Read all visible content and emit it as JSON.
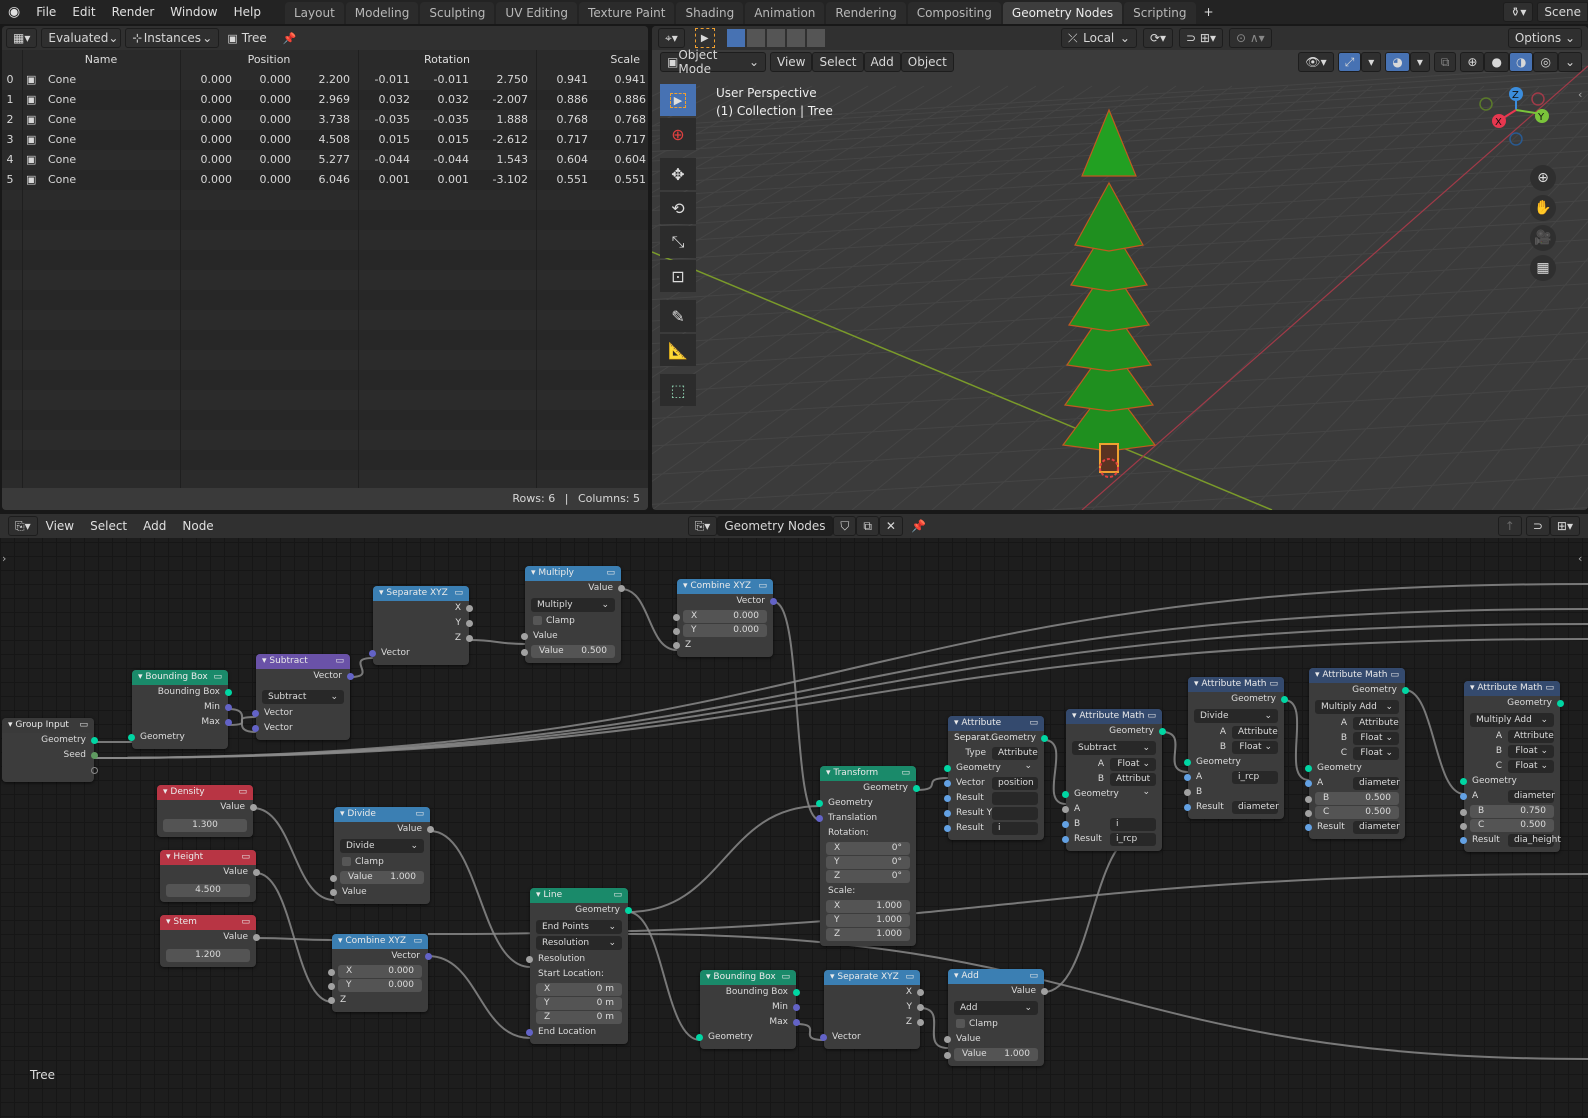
{
  "topbar": {
    "menus": [
      "File",
      "Edit",
      "Render",
      "Window",
      "Help"
    ],
    "workspaces": [
      "Layout",
      "Modeling",
      "Sculpting",
      "UV Editing",
      "Texture Paint",
      "Shading",
      "Animation",
      "Rendering",
      "Compositing",
      "Geometry Nodes",
      "Scripting"
    ],
    "active_workspace": "Geometry Nodes",
    "add_tab": "+",
    "scene_label": "Scene"
  },
  "spreadsheet": {
    "mode": "Evaluated",
    "domain": "Instances",
    "object": "Tree",
    "columns": [
      "Name",
      "Position",
      "Rotation",
      "Scale"
    ],
    "rows": [
      {
        "idx": "0",
        "name": "Cone",
        "pos": [
          "0.000",
          "0.000",
          "2.200"
        ],
        "rot": [
          "-0.011",
          "-0.011",
          "2.750"
        ],
        "scale": [
          "0.941",
          "0.941"
        ]
      },
      {
        "idx": "1",
        "name": "Cone",
        "pos": [
          "0.000",
          "0.000",
          "2.969"
        ],
        "rot": [
          "0.032",
          "0.032",
          "-2.007"
        ],
        "scale": [
          "0.886",
          "0.886"
        ]
      },
      {
        "idx": "2",
        "name": "Cone",
        "pos": [
          "0.000",
          "0.000",
          "3.738"
        ],
        "rot": [
          "-0.035",
          "-0.035",
          "1.888"
        ],
        "scale": [
          "0.768",
          "0.768"
        ]
      },
      {
        "idx": "3",
        "name": "Cone",
        "pos": [
          "0.000",
          "0.000",
          "4.508"
        ],
        "rot": [
          "0.015",
          "0.015",
          "-2.612"
        ],
        "scale": [
          "0.717",
          "0.717"
        ]
      },
      {
        "idx": "4",
        "name": "Cone",
        "pos": [
          "0.000",
          "0.000",
          "5.277"
        ],
        "rot": [
          "-0.044",
          "-0.044",
          "1.543"
        ],
        "scale": [
          "0.604",
          "0.604"
        ]
      },
      {
        "idx": "5",
        "name": "Cone",
        "pos": [
          "0.000",
          "0.000",
          "6.046"
        ],
        "rot": [
          "0.001",
          "0.001",
          "-3.102"
        ],
        "scale": [
          "0.551",
          "0.551"
        ]
      }
    ],
    "footer_rows": "Rows: 6",
    "footer_sep": "|",
    "footer_cols": "Columns: 5"
  },
  "viewport": {
    "transform_orientation": "Local",
    "options": "Options",
    "mode": "Object Mode",
    "menus": [
      "View",
      "Select",
      "Add",
      "Object"
    ],
    "overlay_title": "User Perspective",
    "overlay_sub": "(1) Collection | Tree",
    "gizmo_axes": [
      "X",
      "Y",
      "Z"
    ]
  },
  "node_editor": {
    "menus": [
      "View",
      "Select",
      "Add",
      "Node"
    ],
    "tree_name": "Geometry Nodes",
    "footer_label": "Tree",
    "nodes": {
      "group_input": {
        "title": "Group Input",
        "outputs": [
          "Geometry",
          "Seed"
        ]
      },
      "bbox1": {
        "title": "Bounding Box",
        "outputs": [
          "Bounding Box",
          "Min",
          "Max"
        ],
        "inputs": [
          "Geometry"
        ]
      },
      "subtract": {
        "title": "Subtract",
        "output": "Vector",
        "op": "Subtract",
        "inputs": [
          "Vector",
          "Vector"
        ]
      },
      "sepxyz1": {
        "title": "Separate XYZ",
        "outputs": [
          "X",
          "Y",
          "Z"
        ],
        "input": "Vector"
      },
      "multiply": {
        "title": "Multiply",
        "output": "Value",
        "op": "Multiply",
        "clamp": "Clamp",
        "input": "Value",
        "field_label": "Value",
        "field_value": "0.500"
      },
      "combxyz1": {
        "title": "Combine XYZ",
        "output": "Vector",
        "x": "0.000",
        "y": "0.000",
        "z_label": "Z"
      },
      "density": {
        "title": "Density",
        "output": "Value",
        "value": "1.300"
      },
      "height": {
        "title": "Height",
        "output": "Value",
        "value": "4.500"
      },
      "stem": {
        "title": "Stem",
        "output": "Value",
        "value": "1.200"
      },
      "divide": {
        "title": "Divide",
        "output": "Value",
        "op": "Divide",
        "clamp": "Clamp",
        "field_label": "Value",
        "field_value": "1.000",
        "input": "Value"
      },
      "combxyz2": {
        "title": "Combine XYZ",
        "output": "Vector",
        "x": "0.000",
        "y": "0.000",
        "z_label": "Z"
      },
      "line": {
        "title": "Line",
        "output": "Geometry",
        "mode": "End Points",
        "count_mode": "Resolution",
        "resolution": "Resolution",
        "start_label": "Start Location:",
        "start": [
          "0 m",
          "0 m",
          "0 m"
        ],
        "end_label": "End Location"
      },
      "bbox2": {
        "title": "Bounding Box",
        "outputs": [
          "Bounding Box",
          "Min",
          "Max"
        ],
        "inputs": [
          "Geometry"
        ]
      },
      "sepxyz2": {
        "title": "Separate XYZ",
        "outputs": [
          "X",
          "Y",
          "Z"
        ],
        "input": "Vector"
      },
      "add": {
        "title": "Add",
        "output": "Value",
        "op": "Add",
        "clamp": "Clamp",
        "input": "Value",
        "field_label": "Value",
        "field_value": "1.000"
      },
      "transform": {
        "title": "Transform",
        "output": "Geometry",
        "inputs": [
          "Geometry",
          "Translation"
        ],
        "rot_label": "Rotation:",
        "rot": [
          "0°",
          "0°",
          "0°"
        ],
        "scale_label": "Scale:",
        "scale": [
          "1.000",
          "1.000",
          "1.000"
        ]
      },
      "attrsep": {
        "title": "Attribute Separat...",
        "output": "Geometry",
        "type_label": "Type",
        "type": "Attribute",
        "inputs": [
          {
            "label": "Geometry",
            "val": ""
          },
          {
            "label": "Vector",
            "val": "position"
          },
          {
            "label": "Result",
            "val": ""
          },
          {
            "label": "Result Y",
            "val": ""
          },
          {
            "label": "Result",
            "val": "i"
          }
        ]
      },
      "am1": {
        "title": "Attribute Math",
        "output": "Geometry",
        "op": "Subtract",
        "a_type": "Float",
        "b_type": "Attribut",
        "b": "i",
        "result": "i_rcp"
      },
      "am2": {
        "title": "Attribute Math",
        "output": "Geometry",
        "op": "Divide",
        "a_type": "Attribute",
        "b_type": "Float",
        "a": "i_rcp",
        "result": "diameter"
      },
      "am3": {
        "title": "Attribute Math",
        "output": "Geometry",
        "op": "Multiply Add",
        "a_type": "Attribute",
        "b_type": "Float",
        "c_type": "Float",
        "a": "diameter",
        "b": "0.500",
        "c": "0.500",
        "result": "diameter"
      },
      "am4": {
        "title": "Attribute Math",
        "output": "Geometry",
        "op": "Multiply Add",
        "a_type": "Attribute",
        "b_type": "Float",
        "c_type": "Float",
        "a": "diameter",
        "b": "0.750",
        "c": "0.500",
        "result": "dia_height"
      }
    }
  },
  "colors": {
    "accent": "#4772b3",
    "geometry_socket": "#00d6a3",
    "vector_socket": "#6363c7"
  }
}
